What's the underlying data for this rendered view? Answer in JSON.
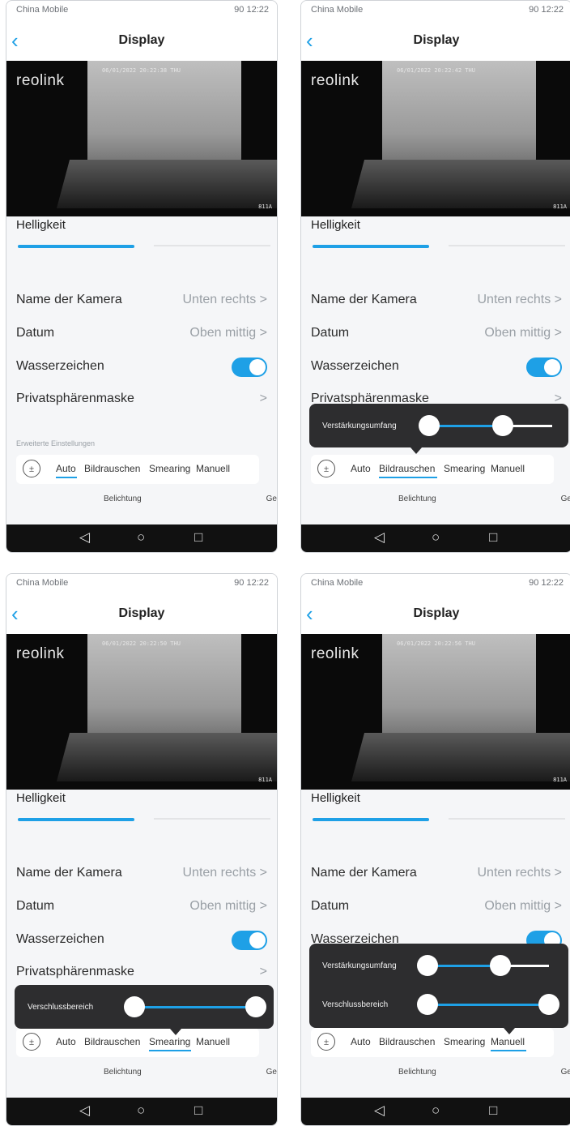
{
  "status": {
    "carrier": "China Mobile",
    "battery": "90",
    "time": "12:22"
  },
  "nav": {
    "back": "‹",
    "title": "Display"
  },
  "video": {
    "brand": "reolink",
    "code": "811A",
    "timestamps": [
      "06/01/2022 20:22:38 THU",
      "06/01/2022 20:22:42 THU",
      "06/01/2022 20:22:50 THU",
      "06/01/2022 20:22:56 THU"
    ]
  },
  "brightness": {
    "label": "Helligkeit"
  },
  "settings": {
    "camera_name": {
      "label": "Name der Kamera",
      "value": "Unten rechts",
      "chevron": ">"
    },
    "date": {
      "label": "Datum",
      "value": "Oben mittig",
      "chevron": ">"
    },
    "watermark": {
      "label": "Wasserzeichen",
      "enabled": true
    },
    "privacy": {
      "label": "Privatsphärenmaske",
      "chevron": ">"
    }
  },
  "advanced": {
    "label": "Erweiterte Einstellungen"
  },
  "modes": {
    "icon": "exposure-icon",
    "auto": "Auto",
    "noise": "Bildrauschen",
    "smearing": "Smearing",
    "manual": "Manuell"
  },
  "tabs": {
    "exposure": "Belichtung",
    "next": "Ge"
  },
  "sysnav": {
    "back": "◁",
    "home": "○",
    "recent": "□"
  },
  "popups": {
    "gain": {
      "label": "Verstärkungsumfang",
      "low": 0.0,
      "high": 0.6
    },
    "shutter": {
      "label": "Verschlussbereich",
      "low": 0.0,
      "high": 1.0
    }
  },
  "phones": [
    {
      "selected_mode": "Auto"
    },
    {
      "selected_mode": "Bildrauschen"
    },
    {
      "selected_mode": "Smearing"
    },
    {
      "selected_mode": "Manuell"
    }
  ],
  "colors": {
    "accent": "#1ea0e6",
    "popup": "#2d2d2f"
  }
}
